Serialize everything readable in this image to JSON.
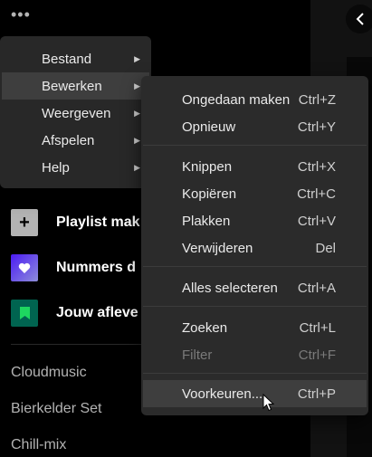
{
  "sidebar": {
    "more_icon": "more-horizontal-icon",
    "items": [
      {
        "label": "Playlist mak",
        "icon": "plus-icon"
      },
      {
        "label": "Nummers d",
        "icon": "heart-icon"
      },
      {
        "label": "Jouw afleve",
        "icon": "bookmark-icon"
      }
    ],
    "playlists": [
      "Cloudmusic",
      "Bierkelder Set",
      "Chill-mix"
    ]
  },
  "main": {
    "back_icon": "chevron-left-icon"
  },
  "menu": {
    "items": [
      {
        "label": "Bestand"
      },
      {
        "label": "Bewerken",
        "active": true
      },
      {
        "label": "Weergeven"
      },
      {
        "label": "Afspelen"
      },
      {
        "label": "Help"
      }
    ]
  },
  "submenu": {
    "items": [
      {
        "label": "Ongedaan maken",
        "shortcut": "Ctrl+Z"
      },
      {
        "label": "Opnieuw",
        "shortcut": "Ctrl+Y"
      },
      {
        "label": "Knippen",
        "shortcut": "Ctrl+X"
      },
      {
        "label": "Kopiëren",
        "shortcut": "Ctrl+C"
      },
      {
        "label": "Plakken",
        "shortcut": "Ctrl+V"
      },
      {
        "label": "Verwijderen",
        "shortcut": "Del"
      },
      {
        "label": "Alles selecteren",
        "shortcut": "Ctrl+A"
      },
      {
        "label": "Zoeken",
        "shortcut": "Ctrl+L"
      },
      {
        "label": "Filter",
        "shortcut": "Ctrl+F",
        "disabled": true
      },
      {
        "label": "Voorkeuren...",
        "shortcut": "Ctrl+P",
        "active": true
      }
    ]
  },
  "colors": {
    "menu_bg": "#282828",
    "highlight": "#3e3e3e",
    "disabled": "#7a7a7a"
  }
}
